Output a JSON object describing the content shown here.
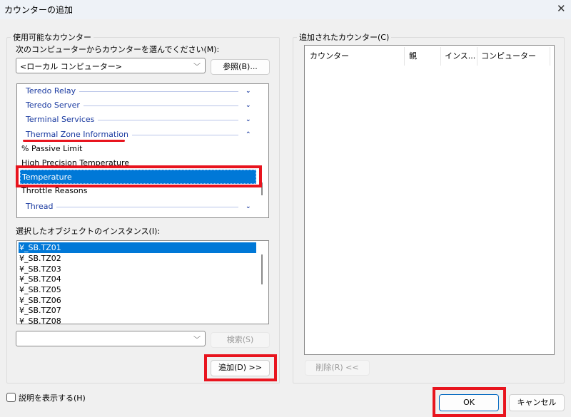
{
  "window": {
    "title": "カウンターの追加",
    "close_icon": "close-icon"
  },
  "available": {
    "group_label": "使用可能なカウンター",
    "computer_label": "次のコンピューターからカウンターを選んでください(M):",
    "computer_value": "<ローカル コンピューター>",
    "browse_label": "参照(B)...",
    "objects": [
      {
        "label": "Teredo Relay",
        "type": "object",
        "expanded": false
      },
      {
        "label": "Teredo Server",
        "type": "object",
        "expanded": false
      },
      {
        "label": "Terminal Services",
        "type": "object",
        "expanded": false
      },
      {
        "label": "Thermal Zone Information",
        "type": "object",
        "expanded": true
      },
      {
        "label": "% Passive Limit",
        "type": "counter"
      },
      {
        "label": "High Precision Temperature",
        "type": "counter"
      },
      {
        "label": "Temperature",
        "type": "counter",
        "selected": true
      },
      {
        "label": "Throttle Reasons",
        "type": "counter"
      },
      {
        "label": "Thread",
        "type": "object",
        "expanded": false
      }
    ],
    "instances_label": "選択したオブジェクトのインスタンス(I):",
    "instances": [
      "¥_SB.TZ01",
      "¥_SB.TZ02",
      "¥_SB.TZ03",
      "¥_SB.TZ04",
      "¥_SB.TZ05",
      "¥_SB.TZ06",
      "¥_SB.TZ07",
      "¥_SB.TZ08"
    ],
    "search_value": "",
    "search_label": "検索(S)",
    "add_label": "追加(D) >>"
  },
  "added": {
    "group_label": "追加されたカウンター(C)",
    "columns": [
      "カウンター",
      "親",
      "インス...",
      "コンピューター"
    ],
    "remove_label": "削除(R) <<"
  },
  "show_description": {
    "label": "説明を表示する(H)",
    "checked": false
  },
  "footer": {
    "ok_label": "OK",
    "cancel_label": "キャンセル"
  },
  "colors": {
    "selection": "#0078d7",
    "object_text": "#1a3aa0",
    "highlight": "#e8141e"
  }
}
